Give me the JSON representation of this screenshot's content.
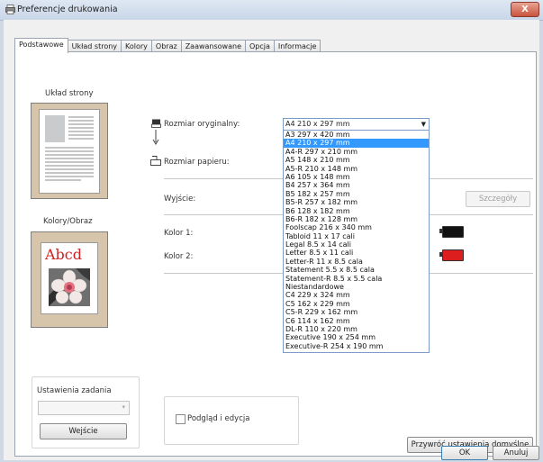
{
  "window": {
    "title": "Preferencje drukowania",
    "close_label": "X"
  },
  "tabs": [
    {
      "label": "Podstawowe",
      "active": true
    },
    {
      "label": "Układ strony"
    },
    {
      "label": "Kolory"
    },
    {
      "label": "Obraz"
    },
    {
      "label": "Zaawansowane"
    },
    {
      "label": "Opcja"
    },
    {
      "label": "Informacje"
    }
  ],
  "left": {
    "layout_label": "Układ strony",
    "color_label": "Kolory/Obraz",
    "sample_text": "Abcd",
    "job_settings_label": "Ustawienia zadania",
    "job_select_value": "",
    "entry_button": "Wejście"
  },
  "form": {
    "original_size_label": "Rozmiar oryginalny:",
    "original_size_value": "A4 210 x 297 mm",
    "paper_size_label": "Rozmiar papieru:",
    "output_label": "Wyjście:",
    "details_button": "Szczegóły",
    "color1_label": "Kolor 1:",
    "color2_label": "Kolor 2:",
    "color1": "#111111",
    "color2": "#dd1e1e"
  },
  "size_options": [
    "A3 297 x 420 mm",
    "A4 210 x 297 mm",
    "A4-R 297 x 210 mm",
    "A5 148 x 210 mm",
    "A5-R 210 x 148 mm",
    "A6 105 x 148 mm",
    "B4 257 x 364 mm",
    "B5 182 x 257 mm",
    "B5-R 257 x 182 mm",
    "B6 128 x 182 mm",
    "B6-R 182 x 128 mm",
    "Foolscap 216 x 340 mm",
    "Tabloid 11 x 17 cali",
    "Legal 8.5 x 14 cali",
    "Letter 8.5 x 11 cali",
    "Letter-R 11 x 8.5 cala",
    "Statement 5.5 x 8.5 cala",
    "Statement-R 8.5 x 5.5 cala",
    "Niestandardowe",
    "C4 229 x 324 mm",
    "C5 162 x 229 mm",
    "C5-R 229 x 162 mm",
    "C6 114 x 162 mm",
    "DL-R 110 x 220 mm",
    "Executive 190 x 254 mm",
    "Executive-R 254 x 190 mm"
  ],
  "selected_option_index": 1,
  "preview_box": {
    "checkbox_label": "Podgląd i edycja",
    "checked": false
  },
  "bottom": {
    "restore_defaults": "Przywróć ustawienia domyślne",
    "ok": "OK",
    "cancel": "Anuluj"
  }
}
